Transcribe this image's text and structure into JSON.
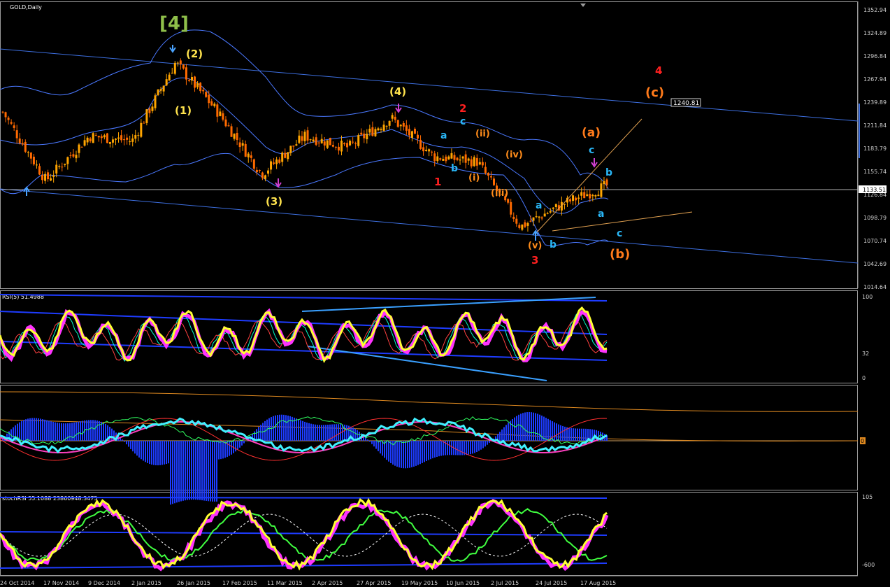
{
  "chart_title": "GOLD,Daily",
  "price_axis": {
    "ticks": [
      "1352.94",
      "1324.89",
      "1296.84",
      "1267.94",
      "1239.89",
      "1211.84",
      "1183.79",
      "1155.74",
      "1126.84",
      "1098.79",
      "1070.74",
      "1042.69",
      "1014.64"
    ],
    "current_price": "1133.51",
    "level_label": "1240.81"
  },
  "date_axis": {
    "ticks": [
      "24 Oct 2014",
      "17 Nov 2014",
      "9 Dec 2014",
      "2 Jan 2015",
      "26 Jan 2015",
      "17 Feb 2015",
      "11 Mar 2015",
      "2 Apr 2015",
      "27 Apr 2015",
      "19 May 2015",
      "10 Jun 2015",
      "2 Jul 2015",
      "24 Jul 2015",
      "17 Aug 2015"
    ]
  },
  "rsi_panel": {
    "title": "RSI(5) 51.4988",
    "ticks": [
      "100",
      "32",
      "0"
    ]
  },
  "macd_panel": {
    "marker": "0"
  },
  "stoch_panel": {
    "title": "stochRSI 55.1088 23860948.3475",
    "ticks": [
      "105",
      "-600"
    ]
  },
  "wave_labels": {
    "w4_big": "[4]",
    "w2": "(2)",
    "w1": "(1)",
    "w3": "(3)",
    "w4": "(4)",
    "red1": "1",
    "red2": "2",
    "red3": "3",
    "red4": "4",
    "c_a1": "a",
    "c_b1": "b",
    "c_c1": "c",
    "o_ii": "(ii)",
    "o_i": "(i)",
    "o_iv": "(iv)",
    "o_iii": "(iii)",
    "o_v": "(v)",
    "c_a2": "a",
    "c_b2": "b",
    "o_a": "(a)",
    "c_c2": "c",
    "c_b3": "b",
    "c_a3": "a",
    "c_c3": "c",
    "o_b": "(b)",
    "o_c": "(c)"
  },
  "colors": {
    "background": "#000000",
    "bull_candle": "#ffa500",
    "bear_candle": "#ff6a00",
    "channel": "#3d6fe0",
    "bollinger": "#4a78ff",
    "rsi_line": "#ffff33",
    "rsi_shadow": "#ff33ff",
    "macd_hist": "#1e3cff",
    "cyan": "#00e5ff",
    "label_yellow": "#ffe34d",
    "label_green": "#8fbf4a",
    "label_red": "#ff2020",
    "label_orange": "#ff7a1a",
    "label_cyan": "#29b6f6"
  },
  "chart_data": {
    "type": "line",
    "title": "GOLD,Daily",
    "xlabel": "",
    "ylabel": "",
    "ylim": [
      1014.64,
      1352.94
    ],
    "x": [
      "24 Oct 2014",
      "17 Nov 2014",
      "9 Dec 2014",
      "2 Jan 2015",
      "26 Jan 2015",
      "17 Feb 2015",
      "11 Mar 2015",
      "2 Apr 2015",
      "27 Apr 2015",
      "19 May 2015",
      "10 Jun 2015",
      "2 Jul 2015",
      "24 Jul 2015",
      "17 Aug 2015",
      "24 Aug 2015"
    ],
    "series": [
      {
        "values": [
          1229,
          1146,
          1200,
          1194,
          1289,
          1228,
          1154,
          1200,
          1186,
          1222,
          1175,
          1169,
          1090,
          1118,
          1140
        ]
      }
    ]
  }
}
